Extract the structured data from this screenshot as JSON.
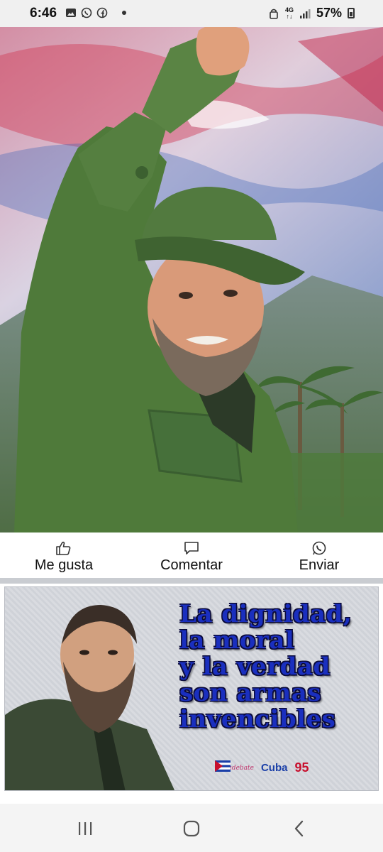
{
  "status_bar": {
    "time": "6:46",
    "left_icons": [
      "gallery-icon",
      "whatsapp-icon",
      "facebook-icon"
    ],
    "network": "4G",
    "battery": "57%"
  },
  "post1": {
    "image": "fidel-castro-fist-raised-photo",
    "actions": [
      {
        "label": "Me gusta",
        "icon": "like-icon"
      },
      {
        "label": "Comentar",
        "icon": "comment-icon"
      },
      {
        "label": "Enviar",
        "icon": "whatsapp-send-icon"
      }
    ]
  },
  "post2": {
    "quote_lines": [
      "La dignidad,",
      "la moral",
      "y la verdad",
      "son armas",
      "invencibles"
    ],
    "logos": {
      "cubadebate": "Cubadebate",
      "cuba": "Cuba",
      "number": "95"
    }
  },
  "nav_bar": {
    "buttons": [
      "recent-apps-icon",
      "home-icon",
      "back-icon"
    ]
  },
  "colors": {
    "quote_text": "#1a2fbf",
    "accent_red": "#c8102e",
    "uniform_green": "#4f7a3a"
  }
}
